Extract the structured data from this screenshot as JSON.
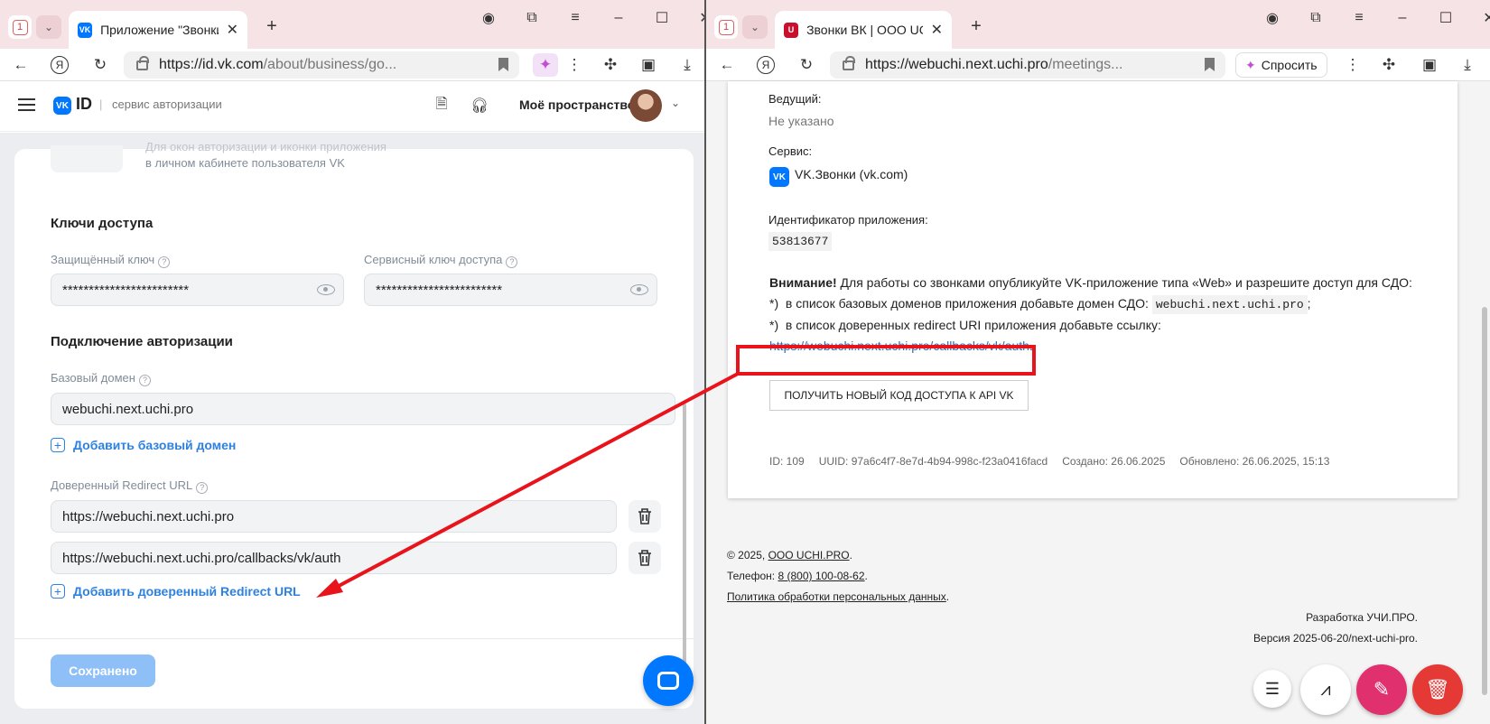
{
  "left_window": {
    "tab_counter": "1",
    "tab_title": "Приложение \"Звонки д",
    "url_host": "https://id.vk.com",
    "url_path": "/about/business/go...",
    "header": {
      "logo_text": "VK",
      "logo_id": "ID",
      "separator": "|",
      "subtitle": "сервис авторизации",
      "space_label": "Моё пространство"
    },
    "card": {
      "ghost_line1": "Для окон авторизации и иконки приложения",
      "ghost_line2": "в личном кабинете пользователя VK",
      "keys_title": "Ключи доступа",
      "protected_key_label": "Защищённый ключ",
      "protected_key_value": "************************",
      "service_key_label": "Сервисный ключ доступа",
      "service_key_value": "************************",
      "auth_title": "Подключение авторизации",
      "base_domain_label": "Базовый домен",
      "base_domain_value": "webuchi.next.uchi.pro",
      "add_base_domain": "Добавить базовый домен",
      "redirect_label": "Доверенный Redirect URL",
      "redirect_urls": [
        "https://webuchi.next.uchi.pro",
        "https://webuchi.next.uchi.pro/callbacks/vk/auth"
      ],
      "add_redirect": "Добавить доверенный Redirect URL",
      "save_label": "Сохранено"
    }
  },
  "right_window": {
    "tab_counter": "1",
    "tab_title": "Звонки ВК | ООО UCHI",
    "url_host": "https://webuchi.next.uchi.pro",
    "url_path": "/meetings...",
    "ask_label": "Спросить",
    "content": {
      "host_label": "Ведущий:",
      "host_value": "Не указано",
      "service_label": "Сервис:",
      "service_value": "VK.Звонки (vk.com)",
      "app_id_label": "Идентификатор приложения:",
      "app_id_value": "53813677",
      "warning_bold": "Внимание!",
      "warning_text": "Для работы со звонками опубликуйте VK-приложение типа «Web» и разрешите доступ для СДО:",
      "step1_prefix": "*)",
      "step1_text": "в список базовых доменов приложения добавьте домен СДО:",
      "step1_code": "webuchi.next.uchi.pro",
      "step1_suffix": ";",
      "step2_prefix": "*)",
      "step2_text": "в список доверенных redirect URI приложения добавьте ссылку:",
      "redirect_link": "https://webuchi.next.uchi.pro/callbacks/vk/auth",
      "redirect_suffix": ".",
      "get_code_button": "ПОЛУЧИТЬ НОВЫЙ КОД ДОСТУПА К API VK",
      "meta_id": "ID:  109",
      "meta_uuid": "UUID:  97a6c4f7-8e7d-4b94-998c-f23a0416facd",
      "meta_created": "Создано:  26.06.2025",
      "meta_updated": "Обновлено:  26.06.2025, 15:13"
    },
    "footer": {
      "copyright_prefix": "©  2025,",
      "company": "ООО UCHI.PRO",
      "phone_prefix": "Телефон:",
      "phone": "8 (800) 100-08-62",
      "privacy": "Политика обработки персональных данных",
      "dev": "Разработка УЧИ.ПРО.",
      "version": "Версия 2025-06-20/next-uchi-pro."
    }
  },
  "colors": {
    "vk_blue": "#0077ff",
    "link_blue": "#2d81e0",
    "annotation_red": "#e8131b",
    "fab_pink": "#e0306e",
    "fab_red": "#e53935",
    "tabstrip": "#f6e3e5"
  },
  "icons": [
    "hamburger-icon",
    "document-icon",
    "headset-icon",
    "eye-icon",
    "trash-icon",
    "chat-icon",
    "list-icon",
    "chart-icon",
    "pencil-icon",
    "delete-icon",
    "lock-icon",
    "bookmark-icon"
  ]
}
